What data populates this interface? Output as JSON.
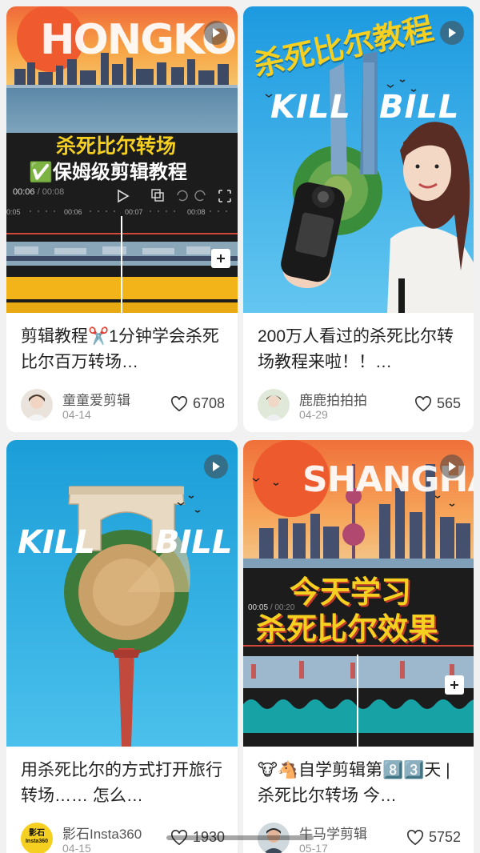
{
  "cards": [
    {
      "cover": {
        "city_text": "HONGKONG",
        "overlay_line1": "杀死比尔转场",
        "overlay_line2": "✅保姆级剪辑教程",
        "time_current": "00:06",
        "time_total": "00:08",
        "ruler": [
          "0:05",
          "00:06",
          "00:07",
          "00:08"
        ]
      },
      "title": "剪辑教程✂️1分钟学会杀死比尔百万转场…",
      "author": "童童爱剪辑",
      "date": "04-14",
      "likes": "6708"
    },
    {
      "cover": {
        "headline": "杀死比尔教程",
        "left_word": "KILL",
        "right_word": "BILL"
      },
      "title": "200万人看过的杀死比尔转场教程来啦！！…",
      "author": "鹿鹿拍拍拍",
      "date": "04-29",
      "likes": "565"
    },
    {
      "cover": {
        "left_word": "KILL",
        "right_word": "BILL"
      },
      "title": "用杀死比尔的方式打开旅行转场…… 怎么…",
      "author": "影石Insta360",
      "avatar_text_top": "影石",
      "avatar_text_bottom": "Insta360",
      "date": "04-15",
      "likes": "1930"
    },
    {
      "cover": {
        "city_text": "SHANGHAI",
        "overlay_line1": "今天学习",
        "overlay_line2": "杀死比尔效果",
        "time_current": "00:05",
        "time_total": "00:20"
      },
      "title": "🐮🐴自学剪辑第8️⃣3️⃣天 | 杀死比尔转场 今…",
      "author": "牛马学剪辑",
      "date": "05-17",
      "likes": "5752"
    }
  ],
  "colors": {
    "accent_yellow": "#f6d020",
    "timeline_red": "#e74c3c",
    "sky_blue": "#2aa7e6",
    "sunset_orange": "#f38b3c"
  }
}
